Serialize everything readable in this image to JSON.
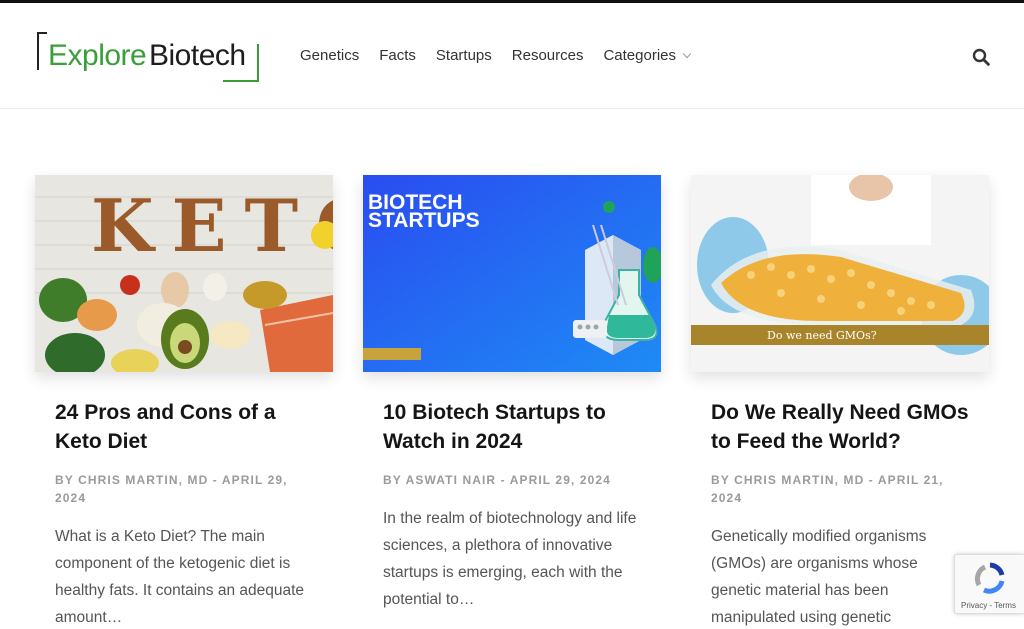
{
  "brand": {
    "word1": "Explore",
    "word2": "Biotech"
  },
  "colors": {
    "accent": "#3a9e3a",
    "text": "#151515",
    "meta": "#9a9a9a"
  },
  "nav": {
    "items": [
      {
        "label": "Genetics"
      },
      {
        "label": "Facts"
      },
      {
        "label": "Startups"
      },
      {
        "label": "Resources"
      },
      {
        "label": "Categories",
        "has_dropdown": true
      }
    ],
    "search_icon": "search-icon"
  },
  "posts": [
    {
      "title": "24 Pros and Cons of a Keto Diet",
      "author": "BY CHRIS MARTIN, MD",
      "date": "- APRIL 29, 2024",
      "excerpt": "What is a Keto Diet? The main component of the ketogenic diet is healthy fats. It contains an adequate amount…",
      "image_text": "KETO"
    },
    {
      "title": "10 Biotech Startups to Watch in 2024",
      "author": "BY ASWATI NAIR",
      "date": "- APRIL 29, 2024",
      "excerpt": "In the realm of biotechnology and life sciences, a plethora of innovative startups is emerging, each with the potential to…",
      "image_text": "BIOTECH STARTUPS"
    },
    {
      "title": "Do We Really Need GMOs to Feed the World?",
      "author": "BY CHRIS MARTIN, MD",
      "date": "- APRIL 21, 2024",
      "excerpt": "Genetically modified organisms (GMOs) are organisms whose genetic material has been manipulated using genetic",
      "image_text": "Do we need GMOs?"
    }
  ],
  "recaptcha": {
    "terms": "Privacy - Terms"
  }
}
